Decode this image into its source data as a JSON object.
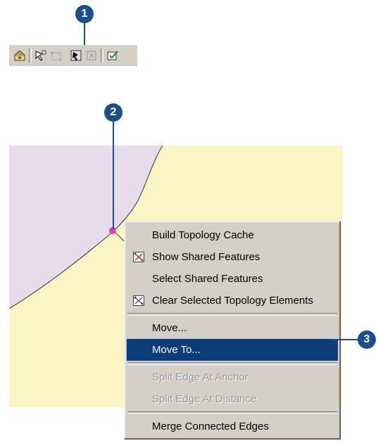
{
  "callouts": {
    "one": "1",
    "two": "2",
    "three": "3"
  },
  "toolbar": {
    "buttons": [
      {
        "name": "topology-icon"
      },
      {
        "name": "topology-edit-tool-icon"
      },
      {
        "name": "fix-topology-error-icon"
      },
      {
        "name": "show-shared-features-icon"
      },
      {
        "name": "error-inspector-icon"
      },
      {
        "name": "validate-topology-icon"
      }
    ]
  },
  "context_menu": {
    "items": [
      {
        "label": "Build Topology Cache",
        "enabled": true
      },
      {
        "label": "Show Shared Features",
        "enabled": true,
        "icon": "shared-features-icon"
      },
      {
        "label": "Select Shared Features",
        "enabled": true
      },
      {
        "label": "Clear Selected Topology Elements",
        "enabled": true,
        "icon": "clear-elements-icon"
      },
      {
        "label": "Move...",
        "enabled": true
      },
      {
        "label": "Move To...",
        "enabled": true,
        "highlighted": true
      },
      {
        "label": "Split Edge At Anchor",
        "enabled": false
      },
      {
        "label": "Split Edge At Distance",
        "enabled": false
      },
      {
        "label": "Merge Connected Edges",
        "enabled": true
      }
    ]
  },
  "colors": {
    "callout": "#1a4e8c",
    "highlight": "#0a3c78",
    "polygon_left": "#e6dcec",
    "polygon_right": "#fbf4c4",
    "vertex": "#e040b0"
  }
}
